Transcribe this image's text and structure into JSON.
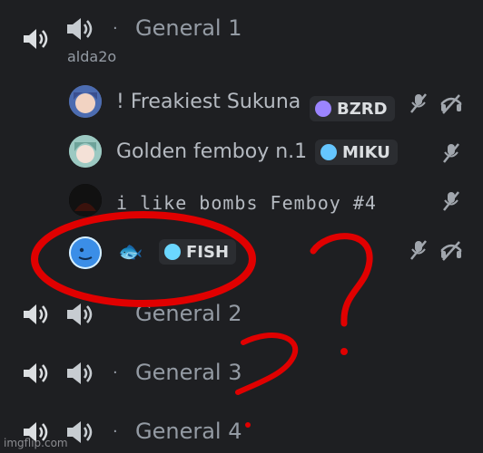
{
  "channels": [
    {
      "name": "General 1"
    },
    {
      "name": "General 2"
    },
    {
      "name": "General 3"
    },
    {
      "name": "General 4"
    }
  ],
  "user_label": "alda2o",
  "members": [
    {
      "name": "! Freakiest Sukuna",
      "tag": "BZRD",
      "tag_color": "#9b84ff",
      "icons": [
        "mic-muted-icon",
        "deafened-icon"
      ]
    },
    {
      "name": "Golden femboy n.1",
      "tag": "MIKU",
      "tag_color": "#65c6ff",
      "icons": [
        "mic-muted-icon"
      ]
    },
    {
      "name": "i like bombs Femboy #4",
      "tag": "",
      "icons": [
        "mic-muted-icon"
      ]
    },
    {
      "name": "🐟",
      "tag": "FISH",
      "tag_color": "#6bd7ff",
      "icons": [
        "mic-muted-icon",
        "deafened-icon"
      ]
    }
  ],
  "separator_dot": "·",
  "watermark": "imgflip.com",
  "colors": {
    "background": "#1e1f22",
    "text_muted": "#949ba4",
    "tag_bg": "#2b2d31",
    "annotation_red": "#e00000"
  },
  "icons": [
    "speaker-icon",
    "speaker-emoji-icon",
    "mic-muted-icon",
    "deafened-icon"
  ]
}
